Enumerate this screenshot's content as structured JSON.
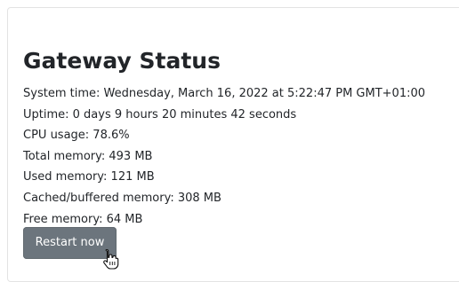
{
  "page": {
    "title": "Gateway Status"
  },
  "status": {
    "lines": [
      "System time: Wednesday, March 16, 2022 at 5:22:47 PM GMT+01:00",
      "Uptime: 0 days 9 hours 20 minutes 42 seconds",
      "CPU usage: 78.6%",
      "Total memory: 493 MB",
      "Used memory: 121 MB",
      "Cached/buffered memory: 308 MB",
      "Free memory: 64 MB"
    ]
  },
  "actions": {
    "restart_label": "Restart now"
  },
  "colors": {
    "button_bg": "#6c757d",
    "text": "#222529"
  },
  "icons": {
    "cursor": "hand-pointer-icon"
  }
}
